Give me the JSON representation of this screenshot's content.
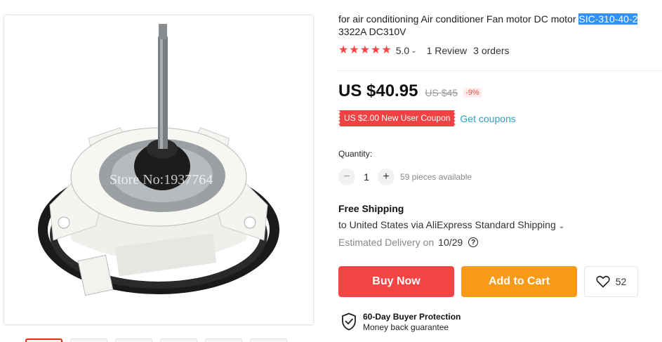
{
  "product": {
    "title_prefix": "for air conditioning Air conditioner Fan motor DC motor ",
    "title_highlight": "SIC-310-40-2",
    "title_suffix": "3322A DC310V",
    "image_watermark": "Store No:1937764"
  },
  "rating": {
    "stars": 5,
    "value": "5.0",
    "reviews": "1 Review",
    "orders": "3 orders"
  },
  "price": {
    "current": "US $40.95",
    "original": "US $45",
    "discount": "-9%"
  },
  "coupon": {
    "label": "US $2.00 New User Coupon",
    "link": "Get coupons"
  },
  "quantity": {
    "label": "Quantity:",
    "value": "1",
    "available": "59 pieces available",
    "minus": "−",
    "plus": "+"
  },
  "shipping": {
    "title": "Free Shipping",
    "destination": "to United States via AliExpress Standard Shipping",
    "estimated_label": "Estimated Delivery on",
    "estimated_date": "10/29"
  },
  "actions": {
    "buy_now": "Buy Now",
    "add_to_cart": "Add to Cart",
    "wishlist_count": "52"
  },
  "protection": {
    "title": "60-Day Buyer Protection",
    "subtitle": "Money back guarantee"
  },
  "colors": {
    "accent_red": "#f44545",
    "cart_orange": "#f89a15",
    "link_blue": "#2e9cc3",
    "star_red": "#ff4747"
  },
  "icons": [
    "star-icon",
    "chevron-down-icon",
    "heart-icon",
    "question-icon",
    "shield-check-icon"
  ]
}
